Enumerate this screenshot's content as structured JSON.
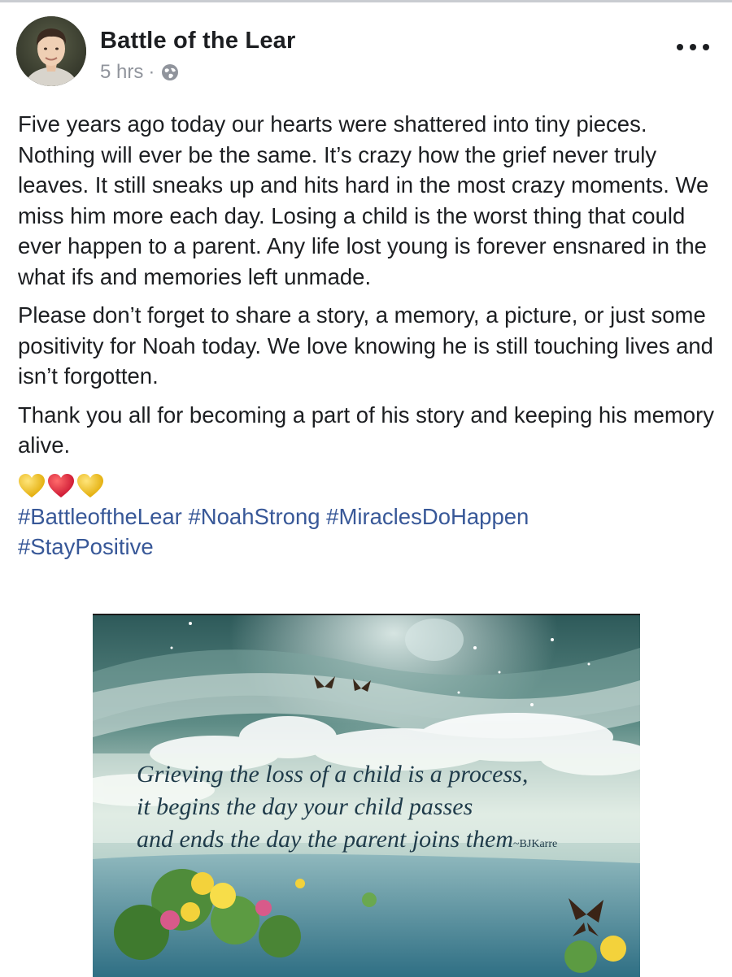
{
  "post": {
    "author": "Battle of the Lear",
    "time": "5 hrs",
    "separator": "·",
    "audience_icon": "globe-icon",
    "more_icon": "more-horizontal-icon",
    "paragraphs": [
      "Five years ago today our hearts were shattered into tiny pieces. Nothing will ever be the same. It’s crazy how the grief never truly leaves. It still sneaks up and hits hard in the most crazy moments. We miss him more each day. Losing a child is the worst thing that could ever happen to a parent. Any life lost young is forever ensnared in the what ifs and memories left unmade.",
      "Please don’t forget to share a story, a memory, a picture, or just some positivity for Noah today. We love knowing he is still touching lives and isn’t forgotten.",
      "Thank you all for becoming a part of his story and keeping his memory alive."
    ],
    "emojis": [
      "yellow-heart",
      "red-heart",
      "yellow-heart"
    ],
    "hashtags": [
      "#BattleoftheLear",
      "#NoahStrong",
      "#MiraclesDoHappen",
      "#StayPositive"
    ]
  },
  "image": {
    "quote_lines": [
      "Grieving the loss of a child is a process,",
      "it begins the day your child passes",
      "and ends the day the parent joins them"
    ],
    "attribution": "~BJKarre"
  },
  "colors": {
    "text": "#1c1e21",
    "meta": "#90949c",
    "link": "#385898",
    "heart_red": "#e0245e",
    "heart_yellow": "#f5c518"
  }
}
